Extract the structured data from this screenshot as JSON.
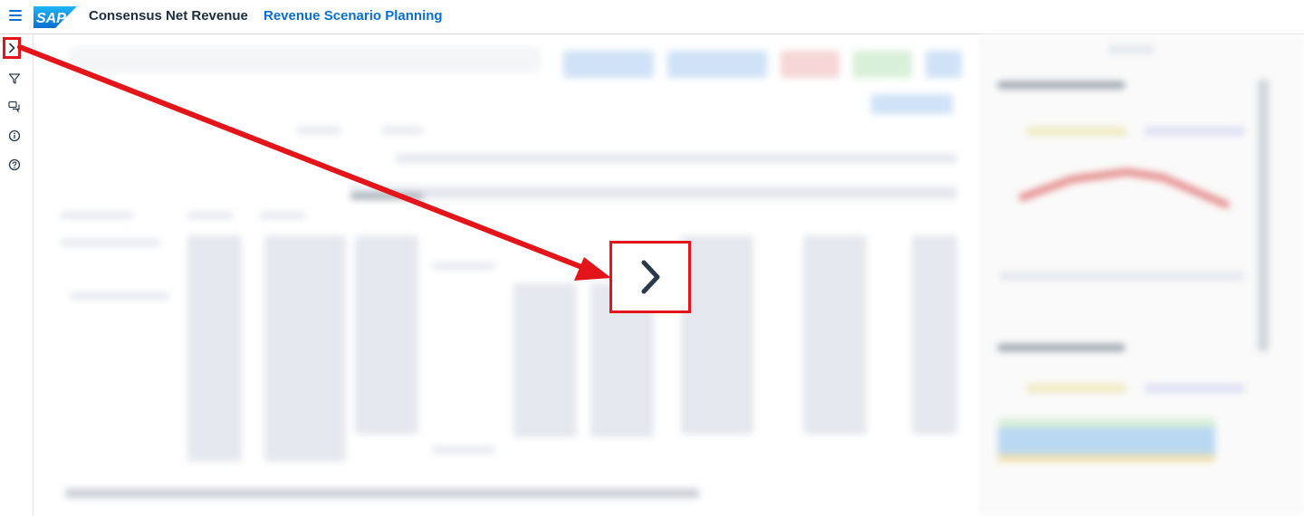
{
  "shell": {
    "app_title": "Consensus Net Revenue",
    "app_subtitle": "Revenue Scenario Planning",
    "logo_text": "SAP",
    "menu_icon": "hamburger-menu-icon"
  },
  "rail": {
    "items": [
      {
        "icon": "chevron-right-icon",
        "action": "expand-panel"
      },
      {
        "icon": "filter-icon"
      },
      {
        "icon": "comments-icon"
      },
      {
        "icon": "info-icon"
      },
      {
        "icon": "help-icon"
      }
    ]
  },
  "annotation": {
    "color": "#e3151a",
    "callout_icon": "chevron-right-icon"
  },
  "colors": {
    "brand_blue": "#0a6ed1",
    "text_dark": "#1d2d3e",
    "icon_dark": "#2b3a4a"
  }
}
